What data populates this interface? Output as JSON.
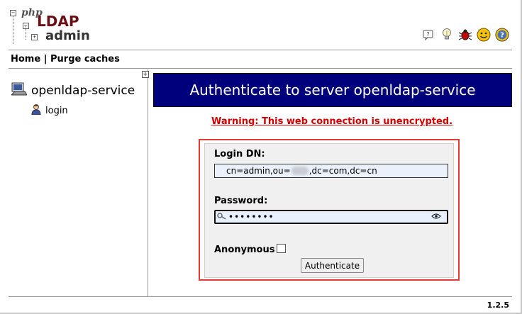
{
  "header": {
    "logo": {
      "php": "php",
      "ldap": "LDAP",
      "admin": "admin"
    },
    "icons": [
      "help-icon",
      "lightbulb-icon",
      "bug-icon",
      "smiley-icon",
      "question-icon"
    ]
  },
  "nav": {
    "home": "Home",
    "separator": "|",
    "purge": "Purge caches"
  },
  "tree": {
    "expand": "+",
    "server": "openldap-service",
    "login": "login"
  },
  "main": {
    "title": "Authenticate to server openldap-service",
    "warning": "Warning: This web connection is unencrypted.",
    "login_dn_label": "Login DN:",
    "login_dn_prefix": "cn=admin,ou=",
    "login_dn_suffix": ",dc=com,dc=cn",
    "password_label": "Password:",
    "password_value": "••••••••",
    "anonymous_label": "Anonymous",
    "anonymous_checked": false,
    "authenticate_button": "Authenticate"
  },
  "footer": {
    "version": "1.2.5"
  },
  "colors": {
    "title_bg": "#00007c",
    "warning": "#d40000",
    "highlight": "#e53935"
  }
}
